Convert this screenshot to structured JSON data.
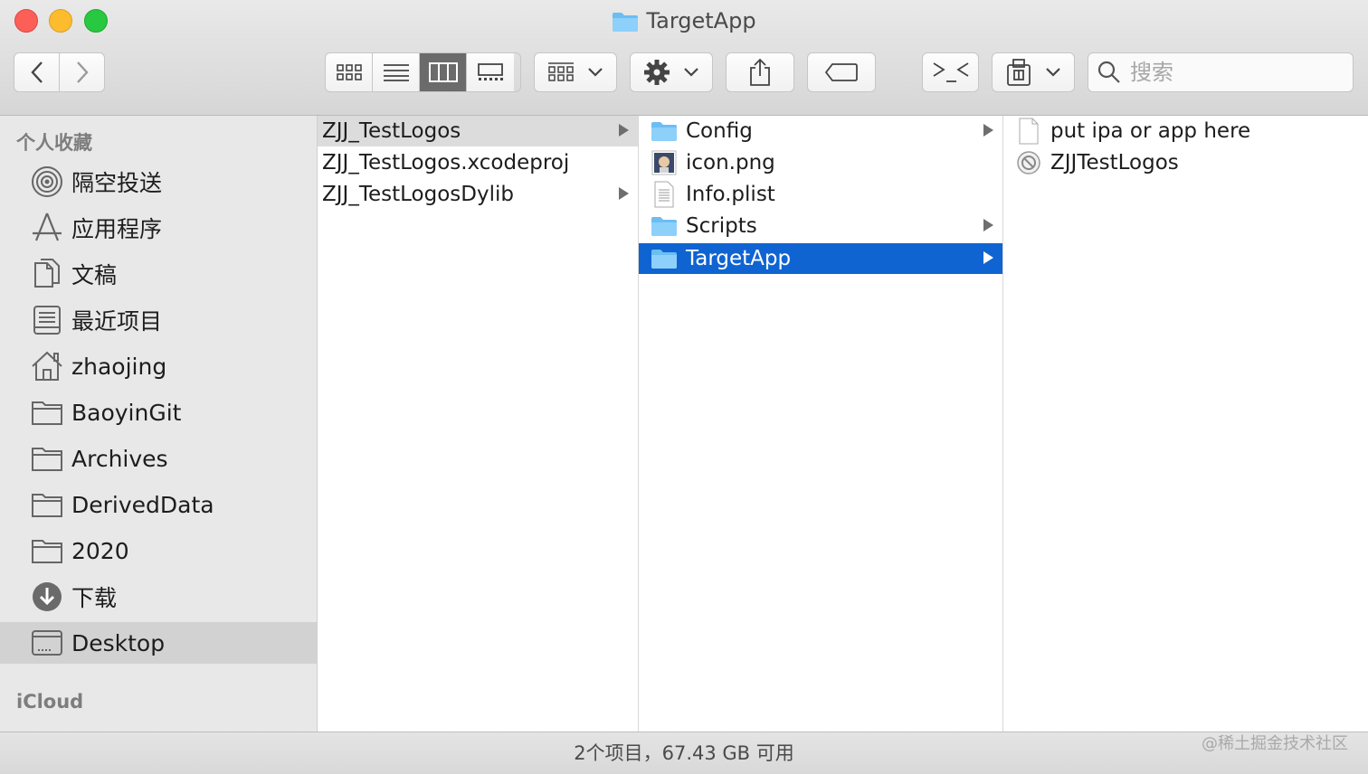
{
  "window": {
    "title": "TargetApp"
  },
  "toolbar": {
    "search_placeholder": "搜索"
  },
  "sidebar": {
    "favorites_header": "个人收藏",
    "items": [
      {
        "label": "隔空投送",
        "icon": "airdrop-icon"
      },
      {
        "label": "应用程序",
        "icon": "applications-icon"
      },
      {
        "label": "文稿",
        "icon": "documents-icon"
      },
      {
        "label": "最近项目",
        "icon": "recents-icon"
      },
      {
        "label": "zhaojing",
        "icon": "home-icon"
      },
      {
        "label": "BaoyinGit",
        "icon": "folder-icon"
      },
      {
        "label": "Archives",
        "icon": "folder-icon"
      },
      {
        "label": "DerivedData",
        "icon": "folder-icon"
      },
      {
        "label": "2020",
        "icon": "folder-icon"
      },
      {
        "label": "下载",
        "icon": "downloads-icon"
      },
      {
        "label": "Desktop",
        "icon": "desktop-icon"
      }
    ],
    "icloud_header": "iCloud"
  },
  "columns": {
    "col1": [
      {
        "name": "ZJJ_TestLogos",
        "has_children": true
      },
      {
        "name": "ZJJ_TestLogos.xcodeproj",
        "has_children": false
      },
      {
        "name": "ZJJ_TestLogosDylib",
        "has_children": true
      }
    ],
    "col2": [
      {
        "name": "Config",
        "has_children": true,
        "icon": "folder-icon"
      },
      {
        "name": "icon.png",
        "has_children": false,
        "icon": "image-file-icon"
      },
      {
        "name": "Info.plist",
        "has_children": false,
        "icon": "plist-file-icon"
      },
      {
        "name": "Scripts",
        "has_children": true,
        "icon": "folder-icon"
      },
      {
        "name": "TargetApp",
        "has_children": true,
        "icon": "folder-icon"
      }
    ],
    "col3": [
      {
        "name": "put ipa or app here",
        "icon": "blank-file-icon"
      },
      {
        "name": "ZJJTestLogos",
        "icon": "blocked-app-icon"
      }
    ]
  },
  "status": {
    "text": "2个项目，67.43 GB 可用"
  },
  "watermark": "@稀土掘金技术社区",
  "colors": {
    "selection": "#0f64d2",
    "folder": "#5ab4f0"
  }
}
